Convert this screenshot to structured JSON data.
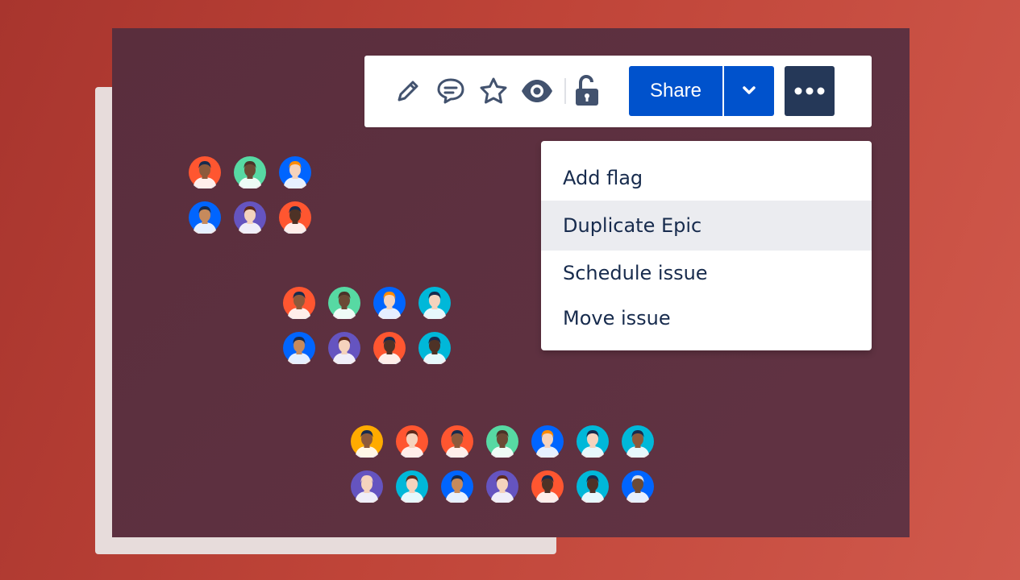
{
  "toolbar": {
    "icons": [
      "pencil-icon",
      "comment-icon",
      "star-icon",
      "eye-icon",
      "unlock-icon"
    ],
    "share_label": "Share",
    "dropdown_icon": "chevron-down-icon",
    "more_icon": "more-horizontal-icon"
  },
  "menu": {
    "items": [
      {
        "label": "Add flag"
      },
      {
        "label": "Duplicate Epic",
        "active": true
      },
      {
        "label": "Schedule issue"
      },
      {
        "label": "Move issue"
      }
    ]
  },
  "colors": {
    "background": "#bf4438",
    "panel": "#5c2f3f",
    "share": "#0052cc",
    "more": "#253858",
    "menu_hover": "#ebecf0",
    "text": "#172b4d"
  },
  "avatars": {
    "group1": [
      {
        "bg": "#ff5630",
        "skin": "#8d5a3b",
        "hair": "#172b4d"
      },
      {
        "bg": "#57d9a3",
        "skin": "#6b4a35",
        "hair": "#4a3328"
      },
      {
        "bg": "#0065ff",
        "skin": "#f5d3bd",
        "hair": "#ff8b00"
      },
      {
        "bg": "#0065ff",
        "skin": "#c68a5c",
        "hair": "#172b4d"
      },
      {
        "bg": "#6554c0",
        "skin": "#f5d3bd",
        "hair": "#5e2a1c"
      },
      {
        "bg": "#ff5630",
        "skin": "#4e3226",
        "hair": "#172b4d"
      }
    ],
    "group2": [
      {
        "bg": "#ff5630",
        "skin": "#8d5a3b",
        "hair": "#172b4d"
      },
      {
        "bg": "#57d9a3",
        "skin": "#6b4a35",
        "hair": "#4a3328"
      },
      {
        "bg": "#0065ff",
        "skin": "#f5d3bd",
        "hair": "#ff8b00"
      },
      {
        "bg": "#00b8d9",
        "skin": "#f5d3bd",
        "hair": "#172b4d"
      },
      {
        "bg": "#0065ff",
        "skin": "#c68a5c",
        "hair": "#172b4d"
      },
      {
        "bg": "#6554c0",
        "skin": "#f5d3bd",
        "hair": "#5e2a1c"
      },
      {
        "bg": "#ff5630",
        "skin": "#4e3226",
        "hair": "#172b4d"
      },
      {
        "bg": "#00b8d9",
        "skin": "#4e3226",
        "hair": "#172b4d"
      }
    ],
    "group3": [
      {
        "bg": "#ffab00",
        "skin": "#8d5a3b",
        "hair": "#172b4d"
      },
      {
        "bg": "#ff5630",
        "skin": "#f5d3bd",
        "hair": "#5e2a1c"
      },
      {
        "bg": "#ff5630",
        "skin": "#8d5a3b",
        "hair": "#172b4d"
      },
      {
        "bg": "#57d9a3",
        "skin": "#6b4a35",
        "hair": "#4a3328"
      },
      {
        "bg": "#0065ff",
        "skin": "#f5d3bd",
        "hair": "#ff8b00"
      },
      {
        "bg": "#00b8d9",
        "skin": "#f5d3bd",
        "hair": "#172b4d"
      },
      {
        "bg": "#00b8d9",
        "skin": "#8d5a3b",
        "hair": "#172b4d"
      },
      {
        "bg": "#6554c0",
        "skin": "#f5d3bd",
        "hair": "#f5d3bd"
      },
      {
        "bg": "#00b8d9",
        "skin": "#f5d3bd",
        "hair": "#5e2a1c"
      },
      {
        "bg": "#0065ff",
        "skin": "#c68a5c",
        "hair": "#172b4d"
      },
      {
        "bg": "#6554c0",
        "skin": "#f5d3bd",
        "hair": "#5e2a1c"
      },
      {
        "bg": "#ff5630",
        "skin": "#4e3226",
        "hair": "#172b4d"
      },
      {
        "bg": "#00b8d9",
        "skin": "#4e3226",
        "hair": "#172b4d"
      },
      {
        "bg": "#0065ff",
        "skin": "#6b4a35",
        "hair": "#dfe1e6"
      }
    ]
  }
}
